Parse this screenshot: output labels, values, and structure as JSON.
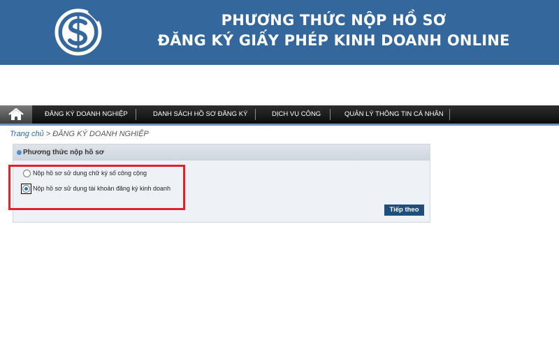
{
  "banner": {
    "title_line1": "PHƯƠNG THỨC NỘP HỒ SƠ",
    "title_line2": "ĐĂNG KÝ GIẤY PHÉP KINH DOANH ONLINE",
    "logo_icon": "dollar-coin-logo-icon",
    "background_color": "#34679c"
  },
  "nav": {
    "home_icon": "home-icon",
    "items": [
      {
        "label": "ĐĂNG KÝ DOANH NGHIỆP"
      },
      {
        "label": "DANH SÁCH HỒ SƠ ĐĂNG KÝ"
      },
      {
        "label": "DỊCH VỤ CÔNG"
      },
      {
        "label": "QUẢN LÝ THÔNG TIN CÁ NHÂN"
      }
    ]
  },
  "breadcrumb": {
    "home": "Trang chủ",
    "separator": " > ",
    "current": "ĐĂNG KÝ DOANH NGHIỆP"
  },
  "panel": {
    "title": "Phương thức nộp hồ sơ",
    "options": [
      {
        "label": "Nộp hồ sơ sử dụng chữ ký số công cộng",
        "selected": false
      },
      {
        "label": "Nộp hồ sơ sử dụng tài khoản đăng ký kinh doanh",
        "selected": true
      }
    ],
    "next_label": "Tiếp theo"
  },
  "colors": {
    "highlight": "#e0202a",
    "button": "#1e4e79",
    "link": "#2f67b2"
  }
}
